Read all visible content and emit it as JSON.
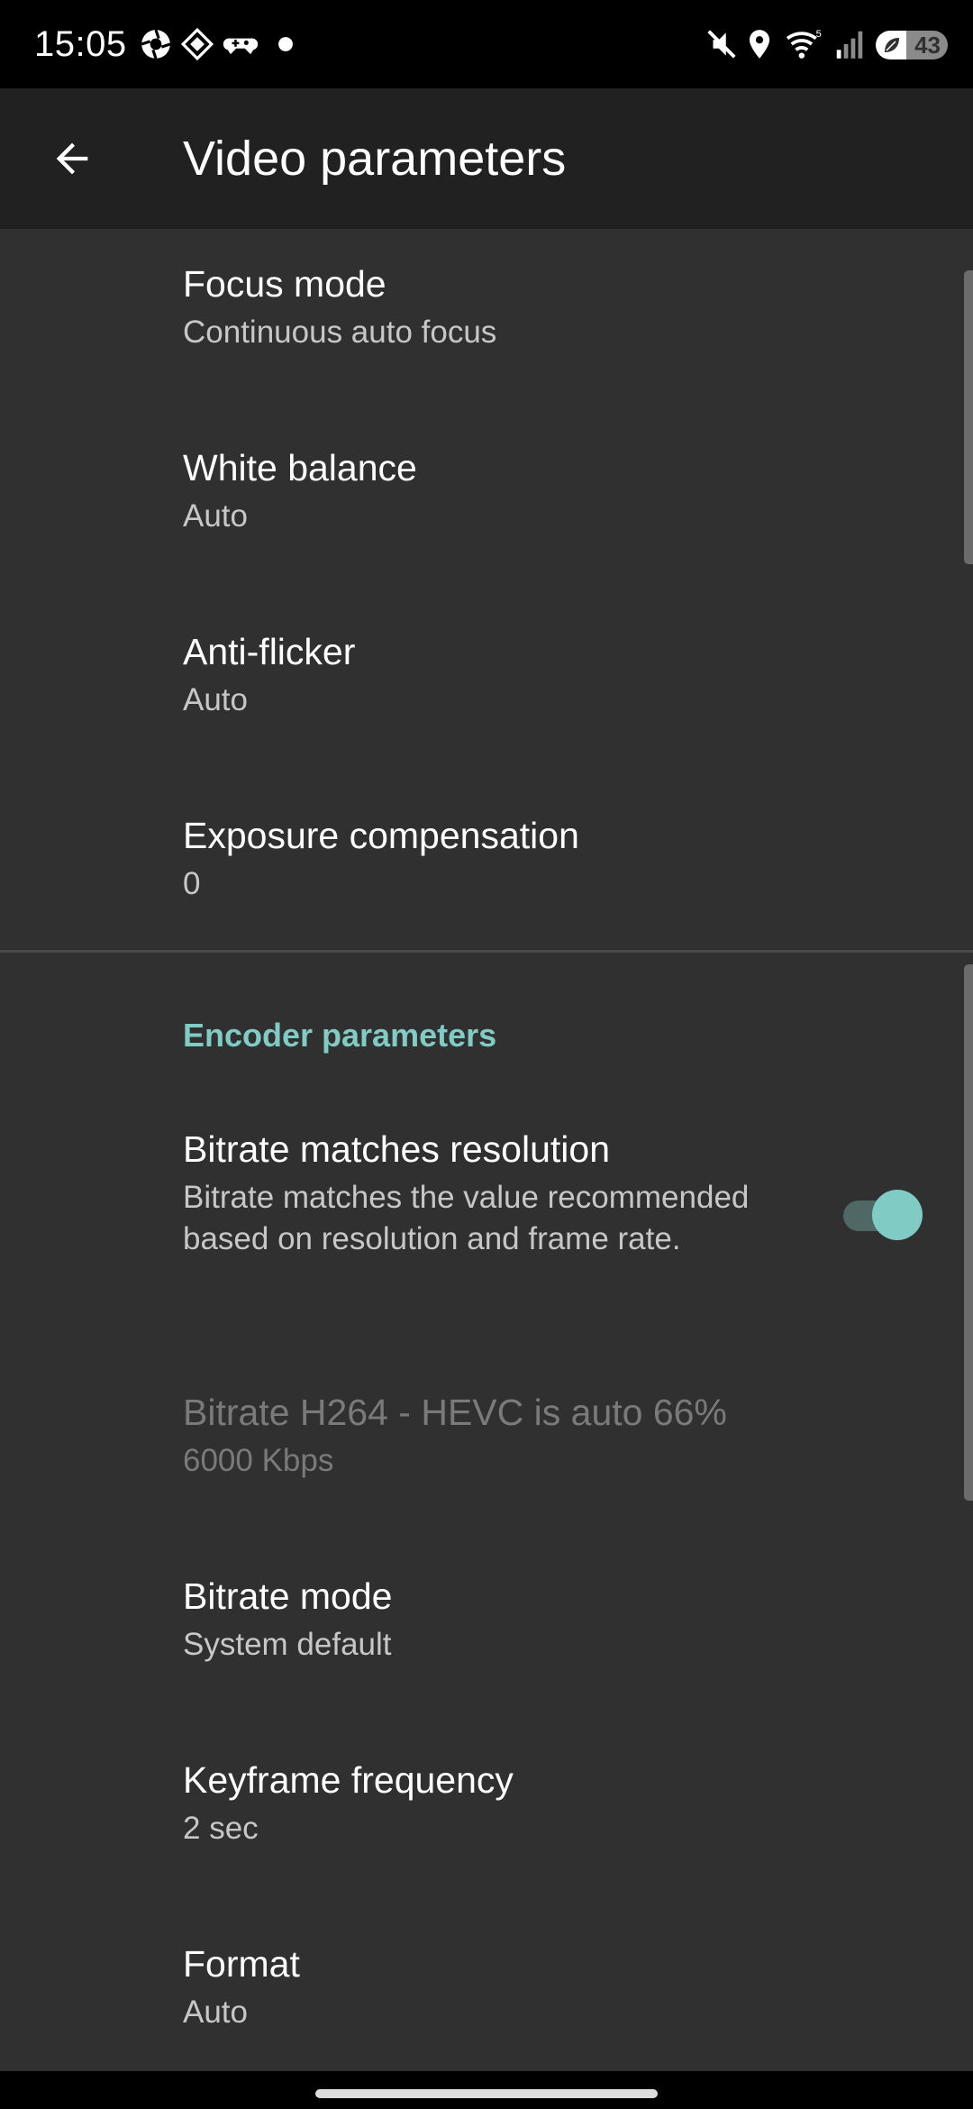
{
  "status_bar": {
    "time": "15:05",
    "notification_icons": [
      "camera-shutter-icon",
      "diamond-app-icon",
      "game-controller-icon",
      "dot-icon"
    ],
    "system_icons": [
      "mute-icon",
      "location-icon",
      "wifi-icon",
      "signal-icon"
    ],
    "battery_level": "43",
    "battery_fraction": 0.43
  },
  "app_bar": {
    "title": "Video parameters",
    "back_icon": "arrow-back-icon"
  },
  "camera_section": {
    "items": [
      {
        "title": "Focus mode",
        "summary": "Continuous auto focus"
      },
      {
        "title": "White balance",
        "summary": "Auto"
      },
      {
        "title": "Anti-flicker",
        "summary": "Auto"
      },
      {
        "title": "Exposure compensation",
        "summary": "0"
      }
    ]
  },
  "encoder_section": {
    "header": "Encoder parameters",
    "bitrate_match": {
      "title": "Bitrate matches resolution",
      "summary": "Bitrate matches the value recommended based on resolution and frame rate.",
      "enabled": true
    },
    "bitrate_h264": {
      "title": "Bitrate H264 - HEVC is auto 66%",
      "summary": "6000 Kbps",
      "disabled": true
    },
    "items": [
      {
        "title": "Bitrate mode",
        "summary": "System default"
      },
      {
        "title": "Keyframe frequency",
        "summary": "2 sec"
      },
      {
        "title": "Format",
        "summary": "Auto"
      }
    ]
  },
  "colors": {
    "accent": "#80cbc4",
    "background": "#303030",
    "app_bar": "#212121"
  }
}
